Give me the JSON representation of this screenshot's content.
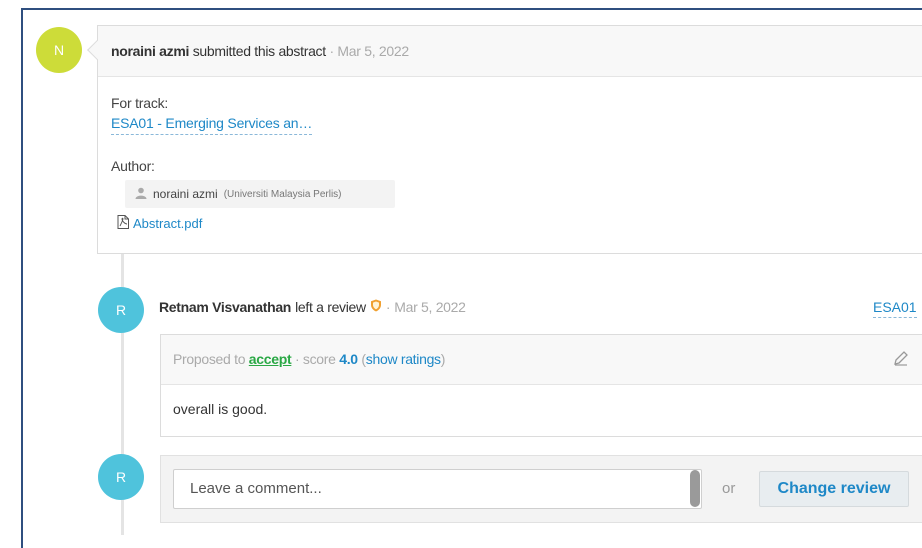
{
  "submission": {
    "avatar_letter": "N",
    "user": "noraini azmi",
    "action": "submitted this abstract",
    "separator": "·",
    "date": "Mar 5, 2022",
    "track_label": "For track:",
    "track_link": "ESA01 - Emerging Services an…",
    "author_label": "Author:",
    "author_name": "noraini azmi",
    "author_affiliation": "(Universiti Malaysia Perlis)",
    "attachment": "Abstract.pdf"
  },
  "review": {
    "avatar_letter": "R",
    "reviewer": "Retnam Visvanathan",
    "action": "left a review",
    "separator": "·",
    "date": "Mar 5, 2022",
    "track_code": "ESA01",
    "proposed_prefix": "Proposed to",
    "proposed_action": "accept",
    "score_prefix": "· score",
    "score": "4.0",
    "paren_open": "(",
    "show_ratings": "show ratings",
    "paren_close": ")",
    "comment": "overall is good."
  },
  "comment_box": {
    "avatar_letter": "R",
    "placeholder": "Leave a comment...",
    "or_label": "or",
    "change_review_label": "Change review"
  },
  "colors": {
    "avatar_n": "#cddc39",
    "avatar_r": "#4fc3dc",
    "link": "#1e88c7",
    "accept": "#2aa845"
  }
}
